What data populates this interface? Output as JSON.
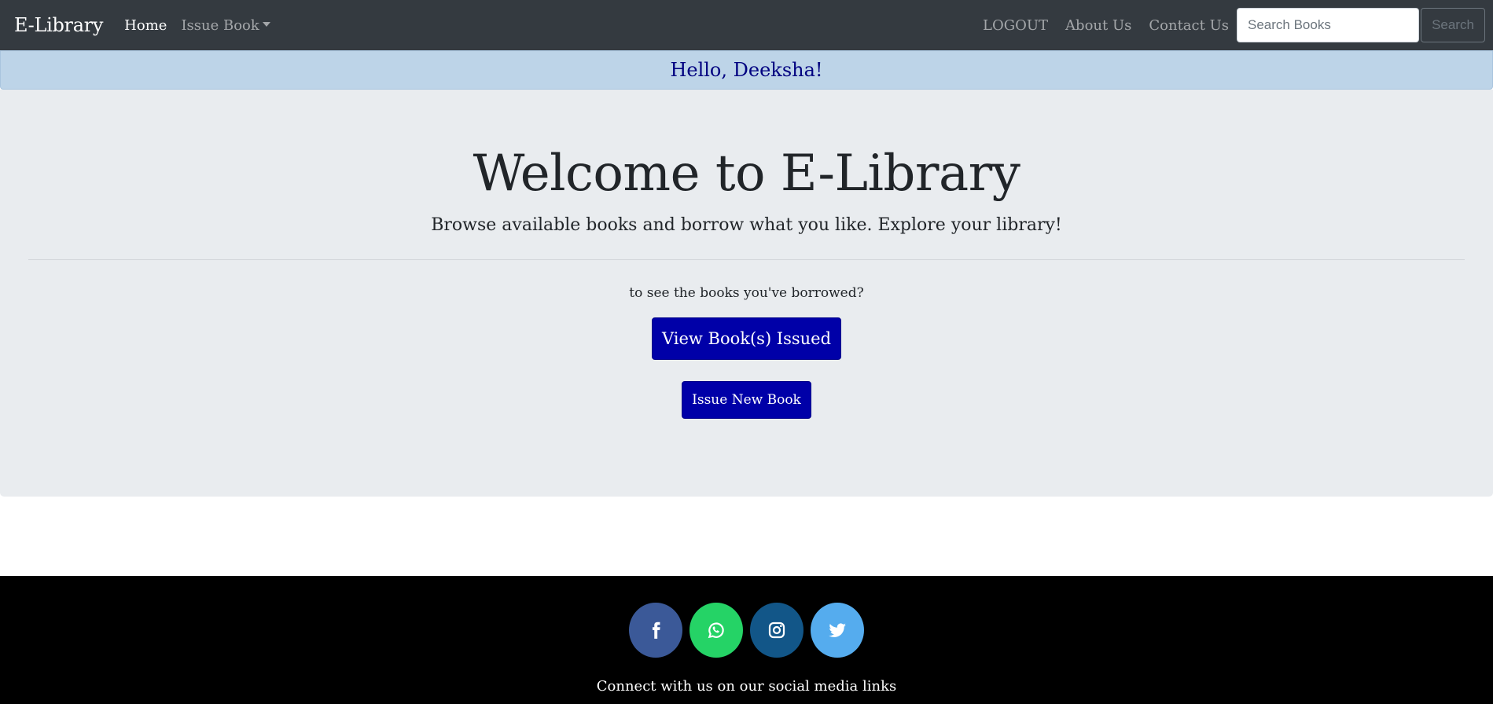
{
  "navbar": {
    "brand": "E-Library",
    "home": "Home",
    "issue_book": "Issue Book",
    "logout": "LOGOUT",
    "about": "About Us",
    "contact": "Contact Us",
    "search_placeholder": "Search Books",
    "search_button": "Search"
  },
  "greeting": "Hello, Deeksha!",
  "jumbotron": {
    "title": "Welcome to E-Library",
    "lead": "Browse available books and borrow what you like. Explore your library!",
    "prompt": "to see the books you've borrowed?",
    "view_button": "View Book(s) Issued",
    "issue_button": "Issue New Book"
  },
  "footer": {
    "text": "Connect with us on our social media links",
    "socials": [
      {
        "icon": "facebook-icon",
        "color": "#3b5998"
      },
      {
        "icon": "whatsapp-icon",
        "color": "#25d366"
      },
      {
        "icon": "instagram-icon",
        "color": "#125688"
      },
      {
        "icon": "twitter-icon",
        "color": "#55acee"
      }
    ]
  },
  "colors": {
    "navbar_bg": "#343a40",
    "greeting_bg": "#bdd4e8",
    "greeting_text": "#000080",
    "jumbotron_bg": "#e9ecef",
    "button_primary": "#0000a8",
    "footer_bg": "#000000"
  }
}
